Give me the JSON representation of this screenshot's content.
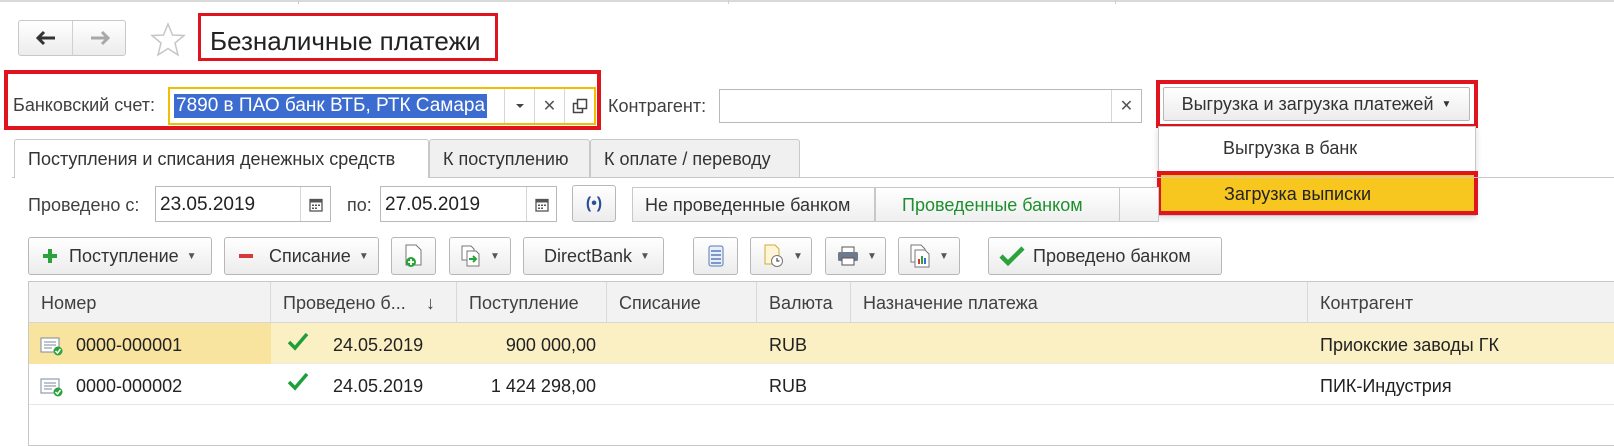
{
  "window": {
    "title": "Безналичные платежи"
  },
  "nav": {
    "back_icon": "arrow-left-icon",
    "forward_icon": "arrow-right-icon",
    "favorite_icon": "star-icon"
  },
  "filters": {
    "bank_account_label": "Банковский счет:",
    "bank_account_value": "7890 в ПАО банк ВТБ, РТК Самара",
    "counterparty_label": "Контрагент:",
    "counterparty_value": ""
  },
  "exchange_menu": {
    "button_label": "Выгрузка и загрузка платежей",
    "items": [
      "Выгрузка в банк",
      "Загрузка выписки"
    ],
    "highlighted_item": "Загрузка выписки"
  },
  "tabs": [
    {
      "label": "Поступления и списания денежных средств",
      "active": true
    },
    {
      "label": "К поступлению",
      "active": false
    },
    {
      "label": "К оплате / переводу",
      "active": false
    }
  ],
  "period": {
    "from_label": "Проведено с:",
    "from_value": "23.05.2019",
    "to_label": "по:",
    "to_value": "27.05.2019"
  },
  "segments": {
    "not_posted": "Не проведенные банком",
    "posted": "Проведенные банком",
    "posted_color": "#1e8f2e"
  },
  "toolbar": {
    "receipt": "Поступление",
    "writeoff": "Списание",
    "directbank": "DirectBank",
    "posted_by_bank": "Проведено банком"
  },
  "table": {
    "columns": [
      "Номер",
      "Проведено б...",
      "Поступление",
      "Списание",
      "Валюта",
      "Назначение платежа",
      "Контрагент"
    ],
    "sort_indicator": "↓",
    "rows": [
      {
        "number": "0000-000001",
        "posted": true,
        "date": "24.05.2019",
        "income": "900 000,00",
        "expense": "",
        "currency": "RUB",
        "purpose": "",
        "counterparty": "Приокские заводы ГК"
      },
      {
        "number": "0000-000002",
        "posted": true,
        "date": "24.05.2019",
        "income": "1 424 298,00",
        "expense": "",
        "currency": "RUB",
        "purpose": "",
        "counterparty": "ПИК-Индустрия"
      }
    ]
  },
  "colors": {
    "highlight_red": "#e0141e",
    "selected_yellow": "#f7c61f",
    "selection_blue": "#3c6ccf",
    "check_green": "#1e9f3c"
  }
}
